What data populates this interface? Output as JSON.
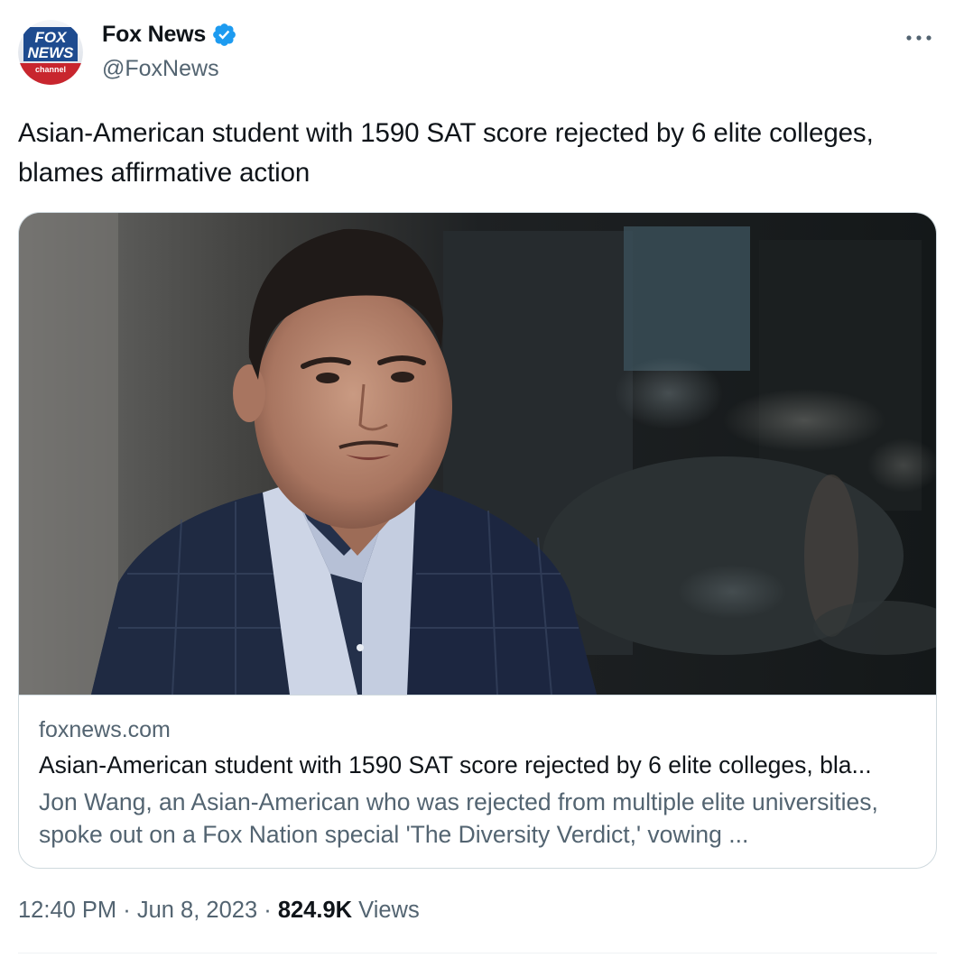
{
  "author": {
    "display_name": "Fox News",
    "handle": "@FoxNews",
    "verified": true,
    "avatar_text": {
      "line1": "FOX",
      "line2": "NEWS",
      "line3": "channel"
    }
  },
  "more_icon": "more-horizontal-icon",
  "tweet_text": "Asian-American student with 1590 SAT score rejected by 6 elite colleges, blames affirmative action",
  "card": {
    "domain": "foxnews.com",
    "title": "Asian-American student with 1590 SAT score rejected by 6 elite colleges, bla...",
    "description": "Jon Wang, an Asian-American who was rejected from multiple elite universities, spoke out on a Fox Nation special 'The Diversity Verdict,' vowing ..."
  },
  "meta": {
    "time": "12:40 PM",
    "separator": "·",
    "date": "Jun 8, 2023",
    "views_count": "824.9K",
    "views_label": "Views"
  },
  "colors": {
    "text_primary": "#0f1419",
    "text_secondary": "#536471",
    "verified_blue": "#1d9bf0",
    "border": "#cfd9de"
  }
}
